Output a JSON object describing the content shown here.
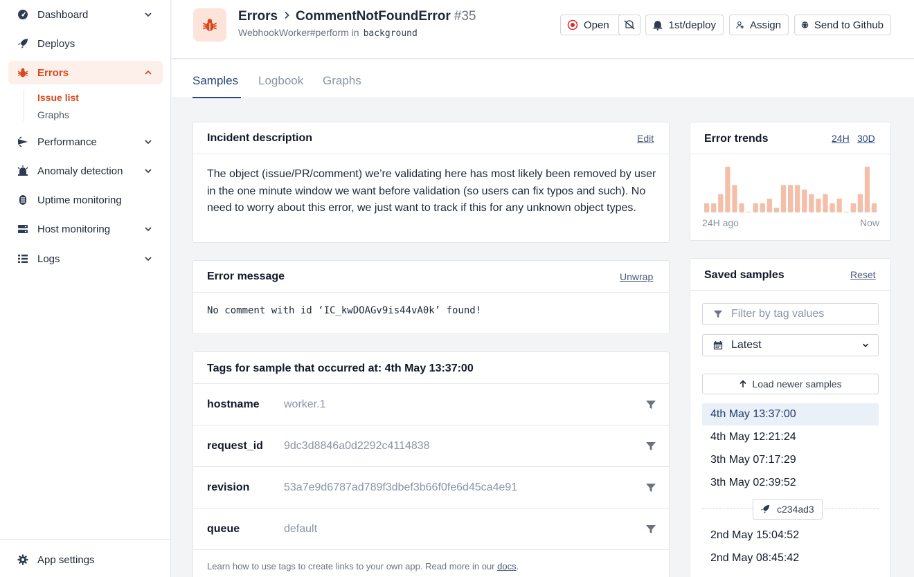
{
  "sidebar": {
    "items": [
      {
        "label": "Dashboard",
        "icon": "dashboard-icon"
      },
      {
        "label": "Deploys",
        "icon": "rocket-icon"
      },
      {
        "label": "Errors",
        "icon": "bug-icon"
      },
      {
        "label": "Performance",
        "icon": "performance-icon"
      },
      {
        "label": "Anomaly detection",
        "icon": "siren-icon"
      },
      {
        "label": "Uptime monitoring",
        "icon": "uptime-icon"
      },
      {
        "label": "Host monitoring",
        "icon": "server-icon"
      },
      {
        "label": "Logs",
        "icon": "list-icon"
      }
    ],
    "errors_sub": [
      "Issue list",
      "Graphs"
    ],
    "footer_label": "App settings"
  },
  "header": {
    "section": "Errors",
    "issue_name": "CommentNotFoundError",
    "issue_number": "#35",
    "action": "WebhookWorker#perform in",
    "namespace": "background",
    "buttons": {
      "open": "Open",
      "deploy": "1st/deploy",
      "assign": "Assign",
      "github": "Send to Github"
    }
  },
  "tabs": [
    "Samples",
    "Logbook",
    "Graphs"
  ],
  "incident": {
    "title": "Incident description",
    "edit": "Edit",
    "text": "The object (issue/PR/comment) we’re validating here has most likely been removed by user in the one minute window we want before validation (so users can fix typos and such). No need to worry about this error, we just want to track if this for any unknown object types."
  },
  "error_message": {
    "title": "Error message",
    "unwrap": "Unwrap",
    "text": "No comment with id ‘IC_kwDOAGv9is44vA0k’ found!"
  },
  "tags": {
    "title": "Tags for sample that occurred at: 4th May 13:37:00",
    "rows": [
      {
        "key": "hostname",
        "value": "worker.1"
      },
      {
        "key": "request_id",
        "value": "9dc3d8846a0d2292c4114838"
      },
      {
        "key": "revision",
        "value": "53a7e9d6787ad789f3dbef3b66f0fe6d45ca4e91"
      },
      {
        "key": "queue",
        "value": "default"
      }
    ],
    "footer_text": "Learn how to use tags to create links to your own app. Read more in our",
    "footer_link": "docs",
    "footer_end": "."
  },
  "trends": {
    "title": "Error trends",
    "range_24h": "24H",
    "range_30d": "30D",
    "axis_start": "24H ago",
    "axis_end": "Now",
    "bar_color": "#f4bfa9",
    "values": [
      2,
      2,
      4,
      10,
      6,
      2,
      0,
      2,
      2,
      3,
      1,
      6,
      6,
      6,
      5,
      4,
      3,
      4,
      2,
      3,
      0,
      2,
      4,
      10,
      2
    ]
  },
  "saved_samples": {
    "title": "Saved samples",
    "reset": "Reset",
    "filter_placeholder": "Filter by tag values",
    "select_value": "Latest",
    "load_newer": "Load newer samples",
    "samples": [
      "4th May 13:37:00",
      "4th May 12:21:24",
      "3th May 07:17:29",
      "3th May 02:39:52"
    ],
    "deploy_chip": "c234ad3",
    "older_samples": [
      "2nd May 15:04:52",
      "2nd May 08:45:42"
    ]
  },
  "colors": {
    "accent": "#d9481c",
    "tab_active": "#27467a"
  }
}
